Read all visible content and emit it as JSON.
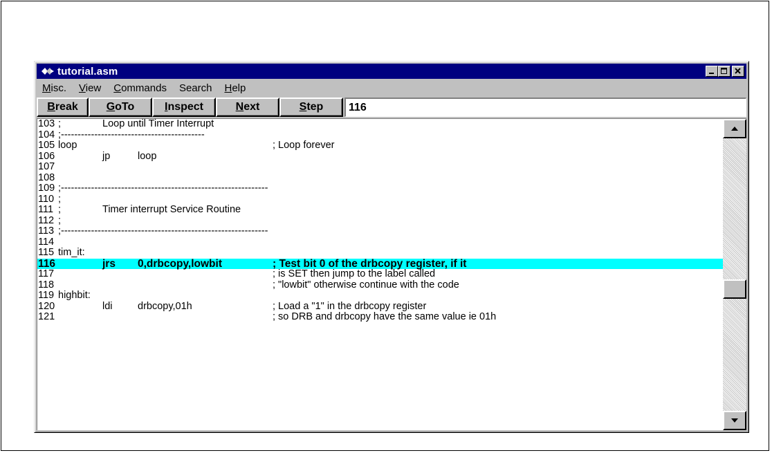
{
  "window": {
    "title": "tutorial.asm",
    "buttons": [
      "minimize",
      "maximize",
      "close"
    ]
  },
  "menu": {
    "items": [
      {
        "label": "Misc.",
        "mnemonic": "M"
      },
      {
        "label": "View",
        "mnemonic": "V"
      },
      {
        "label": "Commands",
        "mnemonic": "C"
      },
      {
        "label": "Search",
        "mnemonic": ""
      },
      {
        "label": "Help",
        "mnemonic": "H"
      }
    ]
  },
  "toolbar": {
    "buttons": [
      {
        "label": "Break",
        "mnemonic": "B"
      },
      {
        "label": "GoTo",
        "mnemonic": "G"
      },
      {
        "label": "Inspect",
        "mnemonic": "I"
      },
      {
        "label": "Next",
        "mnemonic": "N"
      },
      {
        "label": "Step",
        "mnemonic": "S"
      }
    ],
    "goto_value": "116"
  },
  "code": {
    "highlight_color": "#00ffff",
    "current_line": "116",
    "lines": [
      {
        "n": "103",
        "c1": ";",
        "c2": "Loop until Timer Interrupt",
        "c3": "",
        "c4": ""
      },
      {
        "n": "104",
        "c1": ";-------------------------------------------",
        "c2": "",
        "c3": "",
        "c4": ""
      },
      {
        "n": "105",
        "c1": "loop",
        "c2": "",
        "c3": "",
        "c4": "; Loop forever"
      },
      {
        "n": "106",
        "c1": "",
        "c2": "jp",
        "c3": "loop",
        "c4": ""
      },
      {
        "n": "107",
        "c1": "",
        "c2": "",
        "c3": "",
        "c4": ""
      },
      {
        "n": "108",
        "c1": "",
        "c2": "",
        "c3": "",
        "c4": ""
      },
      {
        "n": "109",
        "c1": ";--------------------------------------------------------------",
        "c2": "",
        "c3": "",
        "c4": ""
      },
      {
        "n": "110",
        "c1": ";",
        "c2": "",
        "c3": "",
        "c4": ""
      },
      {
        "n": "111",
        "c1": ";",
        "c2": "Timer interrupt Service Routine",
        "c3": "",
        "c4": ""
      },
      {
        "n": "112",
        "c1": ";",
        "c2": "",
        "c3": "",
        "c4": ""
      },
      {
        "n": "113",
        "c1": ";--------------------------------------------------------------",
        "c2": "",
        "c3": "",
        "c4": ""
      },
      {
        "n": "114",
        "c1": "",
        "c2": "",
        "c3": "",
        "c4": ""
      },
      {
        "n": "115",
        "c1": "tim_it:",
        "c2": "",
        "c3": "",
        "c4": ""
      },
      {
        "n": "116",
        "c1": "",
        "c2": "jrs",
        "c3": "0,drbcopy,lowbit",
        "c4": "; Test bit 0 of the drbcopy register, if it"
      },
      {
        "n": "117",
        "c1": "",
        "c2": "",
        "c3": "",
        "c4": "; is SET then jump to the label called"
      },
      {
        "n": "118",
        "c1": "",
        "c2": "",
        "c3": "",
        "c4": "; \"lowbit\" otherwise continue with the code"
      },
      {
        "n": "119",
        "c1": "highbit:",
        "c2": "",
        "c3": "",
        "c4": ""
      },
      {
        "n": "120",
        "c1": "",
        "c2": "ldi",
        "c3": "drbcopy,01h",
        "c4": "; Load a \"1\" in the drbcopy register"
      },
      {
        "n": "121",
        "c1": "",
        "c2": "",
        "c3": "",
        "c4": "; so DRB and drbcopy have the same value ie 01h"
      }
    ]
  }
}
